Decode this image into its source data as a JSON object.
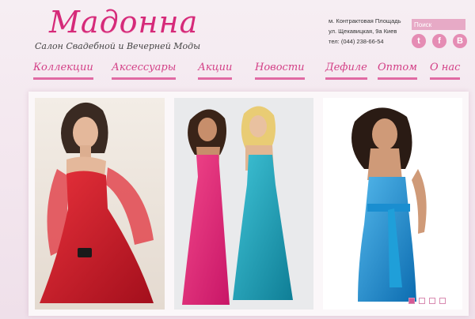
{
  "header": {
    "logo_title": "Мадонна",
    "logo_subtitle": "Салон Свадебной и Вечерней Моды",
    "address_line1": "м. Контрактовая Площадь",
    "address_line2": "ул. Щекавицкая, 9а Киев",
    "phone": "тел: (044) 238-66-54"
  },
  "search": {
    "placeholder": "Поиск"
  },
  "social": [
    {
      "icon": "twitter-icon",
      "glyph": "t"
    },
    {
      "icon": "facebook-icon",
      "glyph": "f"
    },
    {
      "icon": "blogger-icon",
      "glyph": "B"
    }
  ],
  "nav": [
    {
      "label": "Коллекции"
    },
    {
      "label": "Аксессуары"
    },
    {
      "label": "Акции"
    },
    {
      "label": "Новости"
    },
    {
      "label": "Дефиле"
    },
    {
      "label": "Оптом"
    },
    {
      "label": "О нас"
    }
  ],
  "gallery": {
    "slide_count": 4,
    "active_slide": 1
  },
  "colors": {
    "brand_pink": "#d52a79",
    "nav_pink": "#d33f86",
    "search_bg": "#e7aac6",
    "social_bg": "#e58cb4"
  }
}
